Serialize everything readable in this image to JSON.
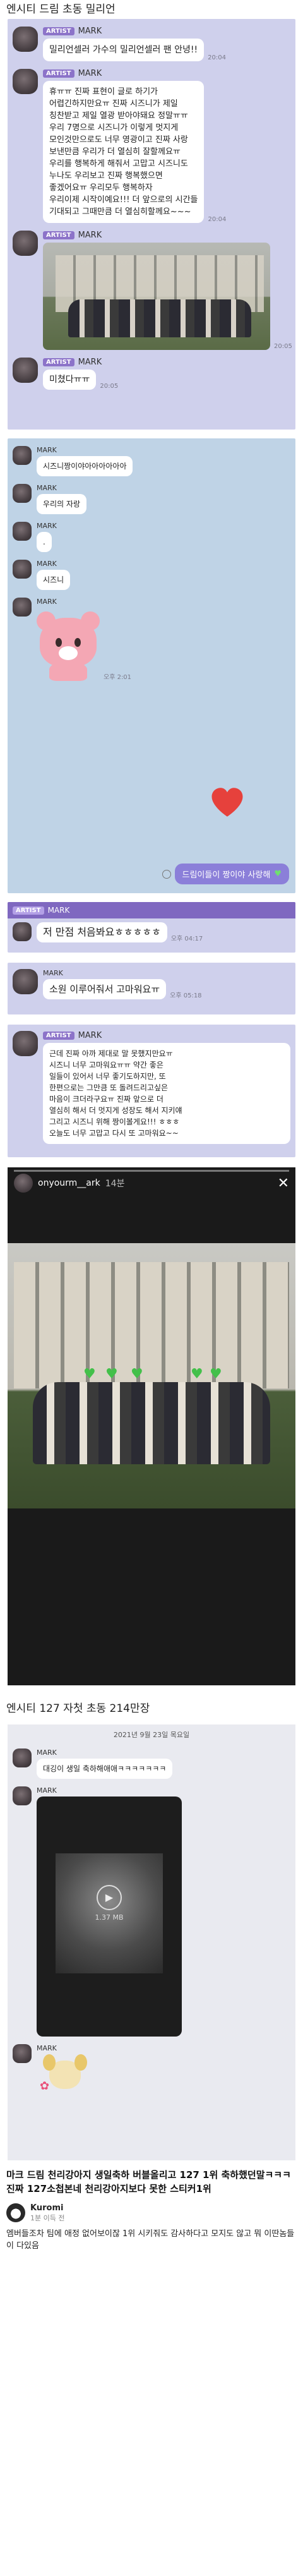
{
  "section1": {
    "title": "엔시티 드림 초동 밀리언",
    "card1": {
      "badge": "ARTIST",
      "sender": "MARK",
      "text": "밀리언셀러 가수의 밀리언셀러 팬        안녕!!",
      "time": "20:04"
    },
    "card2": {
      "badge": "ARTIST",
      "sender": "MARK",
      "text": "휴ㅠㅠ 진짜 표현이 글로 하기가\n어렵긴하지만요ㅠ 진짜 시즈니가 제일\n칭찬받고 제일 열광 받아야돼요 정말ㅠㅠ\n우리 7명으로 시즈니가 이렇게 멋지게\n모인것만으로도 너무 영광이고 진짜 사랑\n보낸만큼 우리가 더 열심히 잘할께요ㅠ\n우리를 행복하게 해줘서 고맙고 시즈니도\n누나도 우리보고 진짜 행복했으면\n좋겠어요ㅠ 우리모두 행복하자\n우리이제 시작이예요!!! 더 앞으로의 시간들\n기대되고 그때만큼 더 열심히할께요~~~",
      "time": "20:04"
    },
    "card3": {
      "badge": "ARTIST",
      "sender": "MARK",
      "time": "20:05"
    },
    "card4": {
      "badge": "ARTIST",
      "sender": "MARK",
      "text": "미쳤다ㅠㅠ",
      "time": "20:05"
    }
  },
  "section2": {
    "sender": "MARK",
    "messages": [
      "시즈니짱이야아아아아아아",
      "우리의 자랑",
      ".",
      "시즈니"
    ],
    "my_reply": "드림이들이 짱이야 사랑해",
    "my_reply_icon": "green-heart-icon",
    "sticker_time": "오후 2:01"
  },
  "section3": {
    "card1": {
      "badge": "ARTIST",
      "sender": "MARK",
      "text": "저 만점 처음봐요ㅎㅎㅎㅎㅎ",
      "time": "오후 04:17"
    },
    "card2": {
      "sender": "MARK",
      "text": "소원 이루어줘서 고마워요ㅠ",
      "time": "오후 05:18"
    },
    "card3": {
      "badge": "ARTIST",
      "sender": "MARK",
      "text": "근데 진짜 아까 제대로 말 못했지만요ㅠ\n시즈니 너무 고마워요ㅠㅠ 약간 좋은\n일들이 있어서 너무 좋기도하지만, 또\n한편으로는 그만큼 또 돌려드리고싶은\n마음이 크더라구요ㅠ 진짜 앞으로 더\n열심히 해서 더 멋지게 성장도 해서 지키얘\n그리고 시즈니 위해 짱이볼게요!!! ㅎㅎㅎ\n오늘도 너무 고맙고 다시 또 고마워요~~"
    }
  },
  "story": {
    "username": "onyourm__ark",
    "age": "14분",
    "hearts": 5
  },
  "section4": {
    "title": "엔시티 127 자첫 초동 214만장",
    "date": "2021년 9월 23일 목요일",
    "sender": "MARK",
    "message": "대깅이 생일 축하해애애ㅋㅋㅋㅋㅋㅋㅋ",
    "video_size": "1.37 MB"
  },
  "post": {
    "title": "마크 드림 천리강아지 생일축하 버블올리고 127 1위 축하했던말ㅋㅋㅋ 진짜 127소첩본네 천리강아지보다 못한 스티커1위",
    "comment_author": "Kuromi",
    "comment_meta": "1분 이득 전",
    "comment_text": "엠버들조차 팀에 애정 없어보이잖 1위 시키줘도 감사하다고 모지도 않고 뭐 이딴놈들이 다있음"
  },
  "colors": {
    "lavender": "#cfd0ec",
    "blue": "#bfd3e6",
    "artist_badge": "#8c73c9",
    "my_bubble": "#8b7fd9",
    "heart": "#e6413c"
  }
}
